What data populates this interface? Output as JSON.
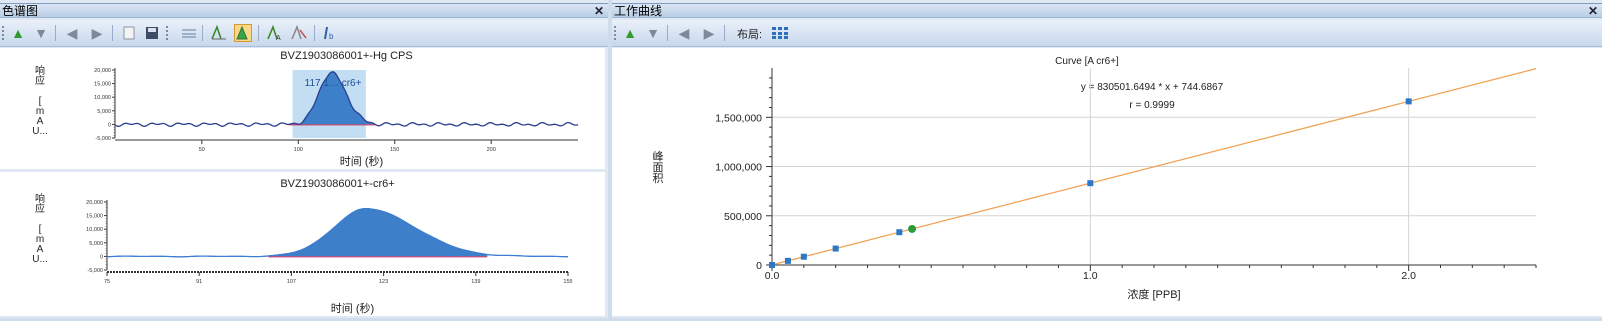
{
  "left_panel": {
    "title": "色谱图",
    "close": "✕",
    "toolbar": {
      "up": "▲",
      "down": "▼",
      "left": "◀",
      "right": "▶"
    },
    "top_chart": {
      "title": "BVZ1903086001+-Hg CPS",
      "ylabel_lines": [
        "响",
        "应",
        "",
        "[",
        "m",
        "A",
        "U..."
      ],
      "xlabel": "时间 (秒)",
      "peak_label": "117.1… cr6+",
      "y_ticks": [
        "20,000",
        "15,000",
        "10,000",
        "5,000",
        "0",
        "-5,000"
      ],
      "x_ticks": [
        "50",
        "100",
        "150",
        "200"
      ]
    },
    "bottom_chart": {
      "title": "BVZ1903086001+-cr6+",
      "ylabel_lines": [
        "响",
        "应",
        "",
        "[",
        "m",
        "A",
        "U..."
      ],
      "xlabel": "时间 (秒)",
      "y_ticks": [
        "20,000",
        "15,000",
        "10,000",
        "5,000",
        "0",
        "-5,000"
      ],
      "x_ticks": [
        "75",
        "91",
        "107",
        "123",
        "139",
        "155"
      ]
    }
  },
  "right_panel": {
    "title": "工作曲线",
    "close": "✕",
    "layout_label": "布局:",
    "chart": {
      "title": "Curve [A cr6+]",
      "equation": "y = 830501.6494 * x  + 744.6867",
      "r_value": "r = 0.9999",
      "ylabel_lines": [
        "峰",
        "面",
        "积"
      ],
      "xlabel": "浓度 [PPB]",
      "y_tick_labels": [
        "1,500,000",
        "1,000,000",
        "500,000",
        "0"
      ],
      "x_tick_labels": [
        "0.0",
        "1.0",
        "2.0"
      ]
    }
  },
  "chart_data": {
    "type": "scatter",
    "title": "Curve [A cr6+]",
    "xlabel": "浓度 [PPB]",
    "ylabel": "峰面积",
    "series": [
      {
        "name": "standards",
        "color": "#2b78c8",
        "x": [
          0.0,
          0.05,
          0.1,
          0.2,
          0.4,
          1.0,
          2.0
        ],
        "y": [
          0,
          42000,
          84000,
          167000,
          333000,
          831000,
          1662000
        ]
      },
      {
        "name": "sample",
        "color": "#2e9b3a",
        "x": [
          0.44
        ],
        "y": [
          366000
        ]
      }
    ],
    "fit": {
      "slope": 830501.6494,
      "intercept": 744.6867,
      "color": "#f0a050"
    },
    "xlim": [
      0,
      2.4
    ],
    "ylim": [
      0,
      1950000
    ],
    "grid": true
  }
}
